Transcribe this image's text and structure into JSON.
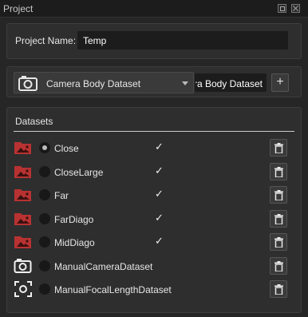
{
  "window": {
    "title": "Project"
  },
  "project": {
    "name_label": "Project Name:",
    "name_value": "Temp"
  },
  "dataset_selector": {
    "selected": "Camera Body Dataset",
    "name_field_value": "ra Body Dataset",
    "add_label": "+"
  },
  "datasets": {
    "header": "Datasets",
    "items": [
      {
        "name": "Close",
        "icon": "folder-image-icon",
        "selected": true,
        "checked": true,
        "check_glyph": "✓"
      },
      {
        "name": "CloseLarge",
        "icon": "folder-image-icon",
        "selected": false,
        "checked": true,
        "check_glyph": "✓"
      },
      {
        "name": "Far",
        "icon": "folder-image-icon",
        "selected": false,
        "checked": true,
        "check_glyph": "✓"
      },
      {
        "name": "FarDiago",
        "icon": "folder-image-icon",
        "selected": false,
        "checked": true,
        "check_glyph": "✓"
      },
      {
        "name": "MidDiago",
        "icon": "folder-image-icon",
        "selected": false,
        "checked": true,
        "check_glyph": "✓"
      },
      {
        "name": "ManualCameraDataset",
        "icon": "camera-icon",
        "selected": false,
        "checked": false,
        "check_glyph": ""
      },
      {
        "name": "ManualFocalLengthDataset",
        "icon": "focus-frame-icon",
        "selected": false,
        "checked": false,
        "check_glyph": ""
      }
    ]
  },
  "colors": {
    "folder_red": "#b83232",
    "panel": "#2e2e2e",
    "background": "#262626"
  }
}
